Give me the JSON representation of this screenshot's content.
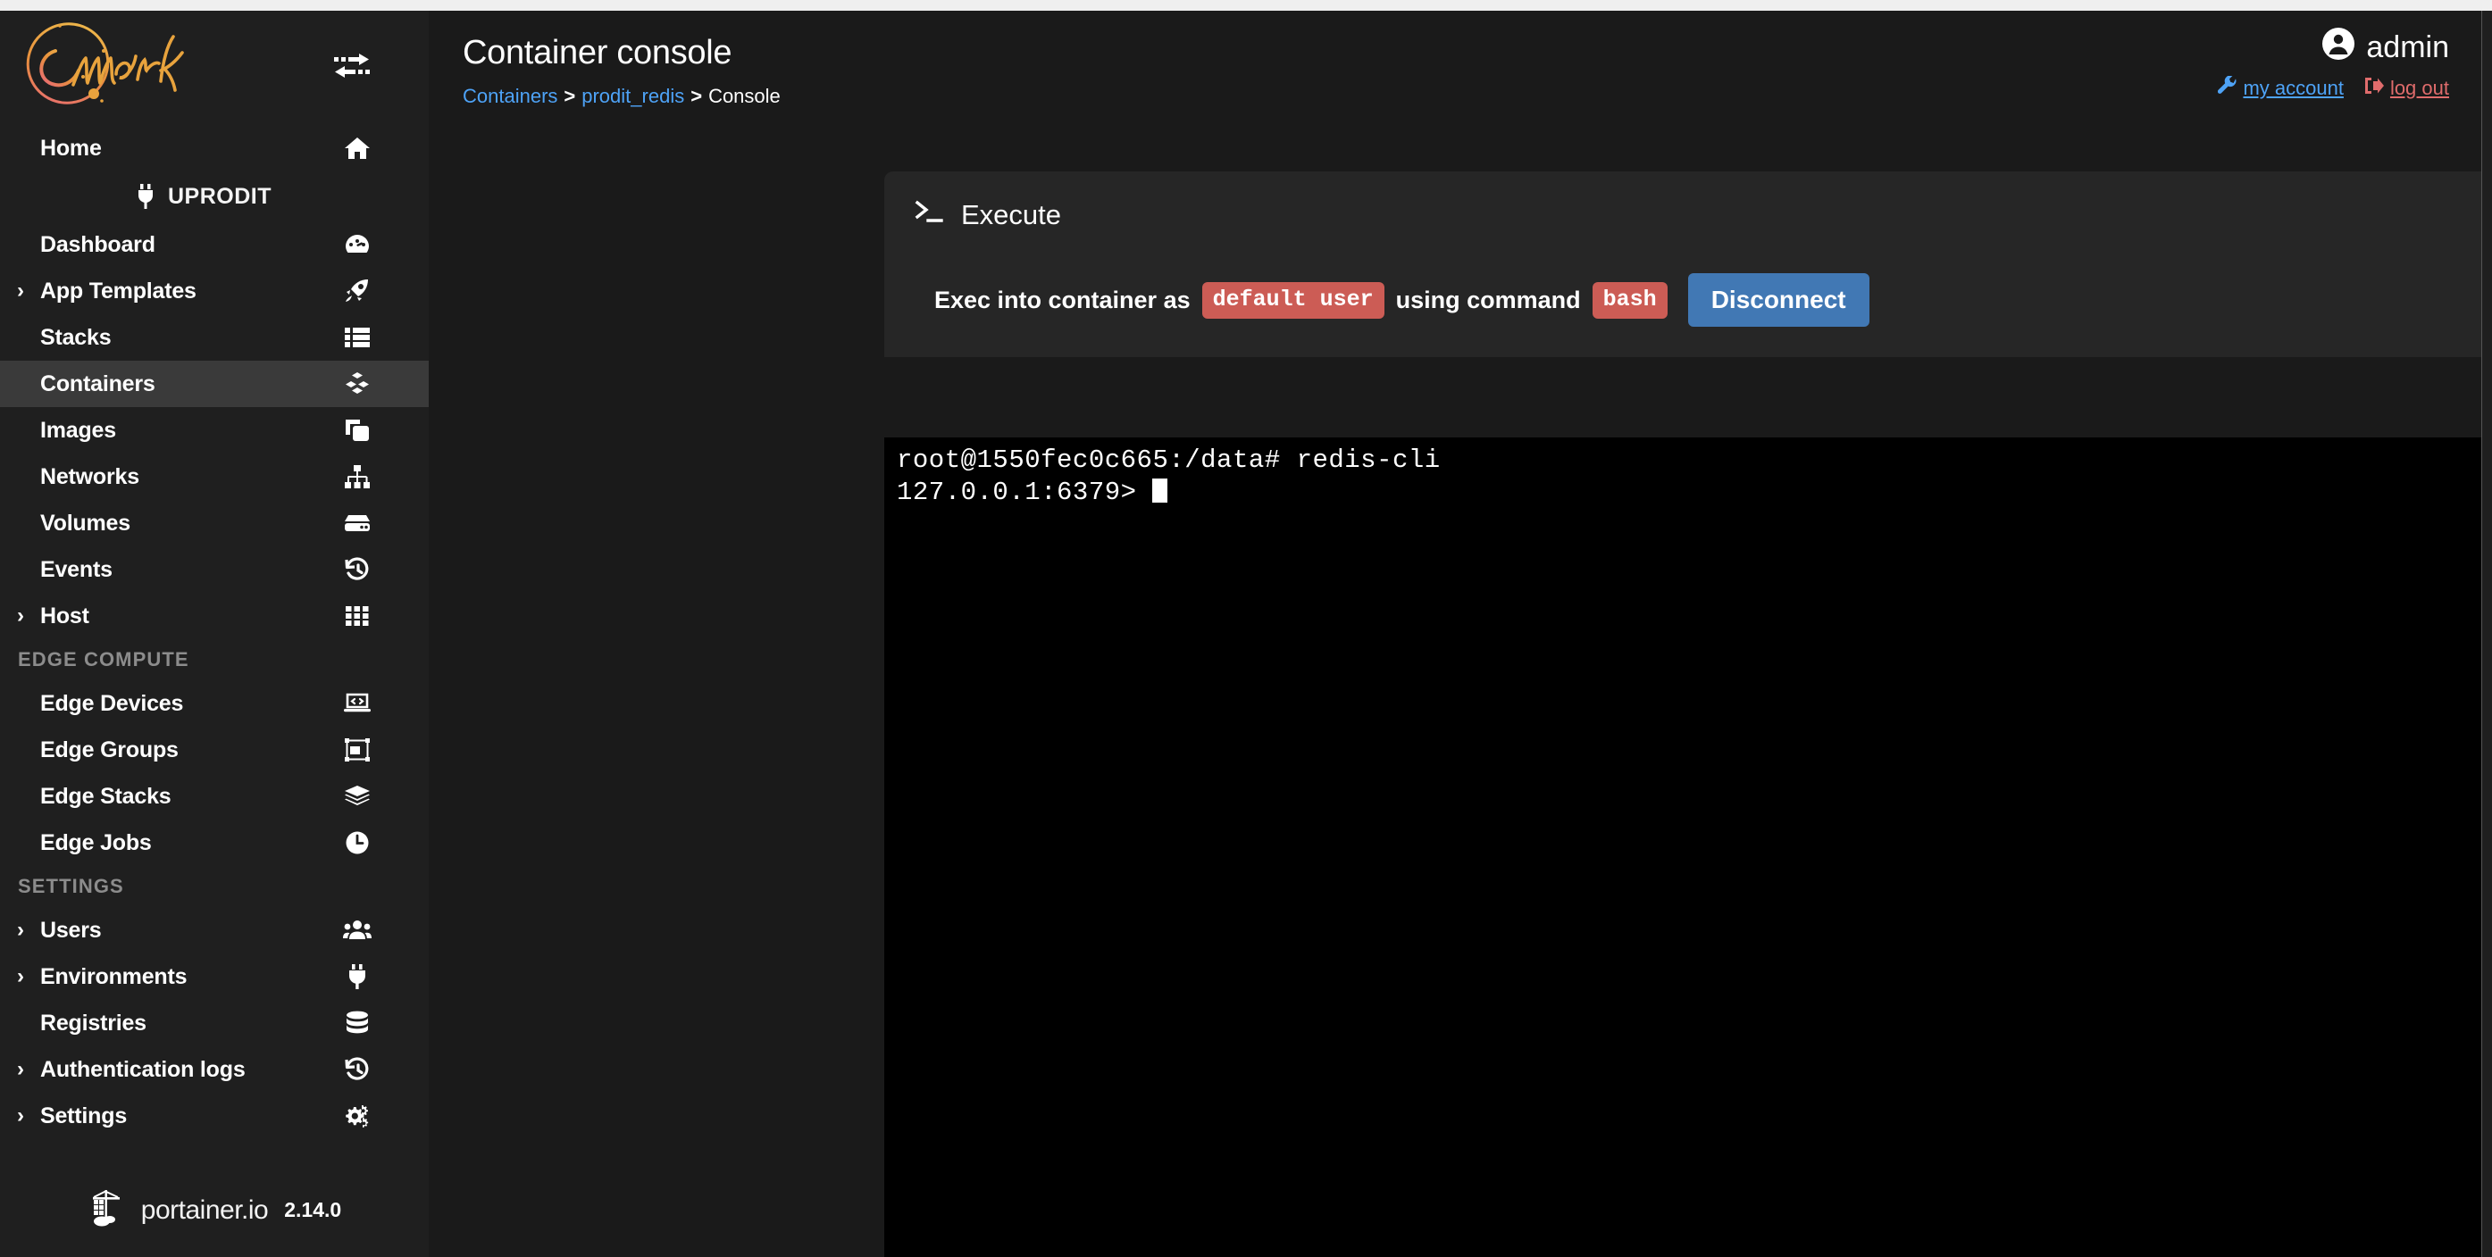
{
  "brand": {
    "logo_text": "Comwork",
    "toggle_icon": "exchange-arrows-icon"
  },
  "sidebar": {
    "items": [
      {
        "label": "Home",
        "icon": "home-icon",
        "caret": false,
        "active": false
      },
      {
        "label": "Dashboard",
        "icon": "tachometer-icon",
        "caret": false,
        "active": false
      },
      {
        "label": "App Templates",
        "icon": "rocket-icon",
        "caret": true,
        "active": false
      },
      {
        "label": "Stacks",
        "icon": "list-icon",
        "caret": false,
        "active": false
      },
      {
        "label": "Containers",
        "icon": "cubes-icon",
        "caret": false,
        "active": true
      },
      {
        "label": "Images",
        "icon": "clone-icon",
        "caret": false,
        "active": false
      },
      {
        "label": "Networks",
        "icon": "sitemap-icon",
        "caret": false,
        "active": false
      },
      {
        "label": "Volumes",
        "icon": "hdd-icon",
        "caret": false,
        "active": false
      },
      {
        "label": "Events",
        "icon": "history-icon",
        "caret": false,
        "active": false
      },
      {
        "label": "Host",
        "icon": "grid-icon",
        "caret": true,
        "active": false
      }
    ],
    "environment": {
      "label": "UPRODIT",
      "icon": "plug-icon"
    },
    "section_edge": "EDGE COMPUTE",
    "edge_items": [
      {
        "label": "Edge Devices",
        "icon": "laptop-code-icon",
        "caret": false
      },
      {
        "label": "Edge Groups",
        "icon": "object-group-icon",
        "caret": false
      },
      {
        "label": "Edge Stacks",
        "icon": "layer-group-icon",
        "caret": false
      },
      {
        "label": "Edge Jobs",
        "icon": "clock-icon",
        "caret": false
      }
    ],
    "section_settings": "SETTINGS",
    "settings_items": [
      {
        "label": "Users",
        "icon": "users-icon",
        "caret": true
      },
      {
        "label": "Environments",
        "icon": "plug-icon",
        "caret": true
      },
      {
        "label": "Registries",
        "icon": "database-icon",
        "caret": false
      },
      {
        "label": "Authentication logs",
        "icon": "history-icon",
        "caret": true
      },
      {
        "label": "Settings",
        "icon": "cogs-icon",
        "caret": true
      }
    ],
    "footer": {
      "product": "portainer.io",
      "version": "2.14.0",
      "icon": "portainer-whale-icon"
    }
  },
  "header": {
    "title": "Container console",
    "breadcrumb": {
      "root": "Containers",
      "sep1": ">",
      "container": "prodit_redis",
      "sep2": ">",
      "current": "Console"
    },
    "user": {
      "name": "admin",
      "avatar_icon": "user-circle-icon",
      "account_link": "my account",
      "account_icon": "wrench-icon",
      "logout_link": "log out",
      "logout_icon": "sign-out-icon"
    }
  },
  "panel": {
    "title": "Execute",
    "title_icon": "terminal-prompt-icon",
    "exec_prefix": "Exec into container as",
    "user_pill": "default user",
    "exec_middle": "using command",
    "command_pill": "bash",
    "disconnect_label": "Disconnect"
  },
  "terminal": {
    "line1": "root@1550fec0c665:/data# redis-cli",
    "line2": "127.0.0.1:6379> "
  },
  "colors": {
    "accent_blue": "#4178b4",
    "link_blue": "#4ea3f7",
    "pill_red": "#cc5c55",
    "logout_red": "#e06c6c",
    "sidebar_bg": "#1f1f1f",
    "page_bg": "#1a1a1a",
    "panel_bg": "#262626",
    "active_item_bg": "#3a3a3a",
    "terminal_bg": "#000000",
    "logo_gold": "#e8a33d"
  }
}
